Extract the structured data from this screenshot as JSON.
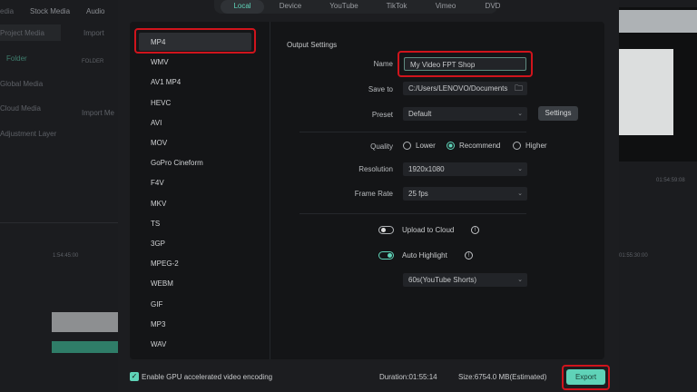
{
  "background_app": {
    "top_tabs": [
      "edia",
      "Stock Media",
      "Audio"
    ],
    "sidebar": [
      "Project Media",
      "Folder",
      "Global Media",
      "Cloud Media",
      "Adjustment Layer"
    ],
    "import_label": "Import",
    "folder_header": "FOLDER",
    "import_media": "Import Me",
    "timeline_time_left": "1:54:45:00",
    "timeline_time_right": "01:55:30:00",
    "preview_time": "01:54:59:08"
  },
  "tabs": [
    {
      "label": "Local",
      "active": true
    },
    {
      "label": "Device"
    },
    {
      "label": "YouTube"
    },
    {
      "label": "TikTok"
    },
    {
      "label": "Vimeo"
    },
    {
      "label": "DVD"
    }
  ],
  "formats": [
    "MP4",
    "WMV",
    "AV1 MP4",
    "HEVC",
    "AVI",
    "MOV",
    "GoPro Cineform",
    "F4V",
    "MKV",
    "TS",
    "3GP",
    "MPEG-2",
    "WEBM",
    "GIF",
    "MP3",
    "WAV"
  ],
  "selected_format": "MP4",
  "settings": {
    "title": "Output Settings",
    "name_label": "Name",
    "name_value": "My Video FPT Shop",
    "save_label": "Save to",
    "save_value": "C:/Users/LENOVO/Documents",
    "preset_label": "Preset",
    "preset_value": "Default",
    "settings_button": "Settings",
    "quality_label": "Quality",
    "quality_options": [
      "Lower",
      "Recommend",
      "Higher"
    ],
    "quality_selected": "Recommend",
    "resolution_label": "Resolution",
    "resolution_value": "1920x1080",
    "framerate_label": "Frame Rate",
    "framerate_value": "25 fps",
    "upload_label": "Upload to Cloud",
    "upload_on": false,
    "highlight_label": "Auto Highlight",
    "highlight_on": true,
    "highlight_value": "60s(YouTube Shorts)"
  },
  "footer": {
    "gpu_label": "Enable GPU accelerated video encoding",
    "gpu_checked": true,
    "duration": "Duration:01:55:14",
    "size": "Size:6754.0 MB(Estimated)",
    "export_label": "Export"
  },
  "colors": {
    "accent": "#5fd3b8",
    "highlight_box": "#d0141c"
  }
}
